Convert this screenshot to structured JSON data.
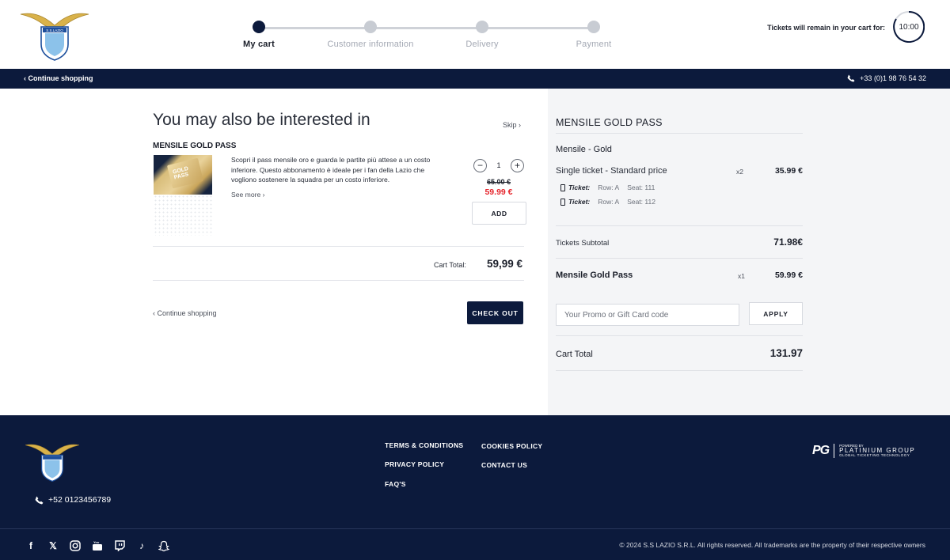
{
  "header": {
    "steps": [
      {
        "label": "My cart"
      },
      {
        "label": "Customer information"
      },
      {
        "label": "Delivery"
      },
      {
        "label": "Payment"
      }
    ],
    "timer_label": "Tickets will remain in your cart for:",
    "timer_value": "10:00"
  },
  "navbar": {
    "continue_label": "Continue shopping",
    "phone": "+33 (0)1 98 76 54 32"
  },
  "upsell": {
    "heading": "You may also be interested in",
    "skip_label": "Skip",
    "product_name": "MENSILE GOLD PASS",
    "image_text": "GOLD PASS",
    "description": "Scopri il pass mensile oro e guarda le partite più attese a un costo inferiore. Questo abbonamento è ideale per i fan della Lazio che vogliono sostenere la squadra per un costo inferiore.",
    "see_more_label": "See more",
    "quantity": "1",
    "old_price": "65.00 €",
    "new_price": "59.99 €",
    "add_label": "ADD",
    "cart_total_label": "Cart Total:",
    "cart_total_value": "59,99 €",
    "continue_label": "Continue shopping",
    "checkout_label": "CHECK OUT"
  },
  "summary": {
    "title": "MENSILE GOLD PASS",
    "subtitle": "Mensile - Gold",
    "ticket_line": {
      "label": "Single ticket - Standard price",
      "qty": "x2",
      "price": "35.99 €"
    },
    "seats": [
      {
        "ticket_label": "Ticket:",
        "row": "Row: A",
        "seat": "Seat: 111"
      },
      {
        "ticket_label": "Ticket:",
        "row": "Row: A",
        "seat": "Seat: 112"
      }
    ],
    "tickets_subtotal_label": "Tickets Subtotal",
    "tickets_subtotal_value": "71.98€",
    "gold_pass": {
      "label": "Mensile Gold Pass",
      "qty": "x1",
      "price": "59.99 €"
    },
    "promo_placeholder": "Your Promo or Gift Card code",
    "apply_label": "APPLY",
    "cart_total_label": "Cart Total",
    "cart_total_value": "131.97"
  },
  "footer": {
    "phone": "+52 0123456789",
    "links_col1": [
      "TERMS & CONDITIONS",
      "PRIVACY POLICY",
      "FAQ'S"
    ],
    "links_col2": [
      "COOKIES POLICY",
      "CONTACT US"
    ],
    "powered": {
      "line1": "POWERED BY",
      "line2": "PLATINIUM GROUP",
      "line3": "GLOBAL TICKETING TECHNOLOGY",
      "mark": "PG"
    },
    "copyright": "© 2024 S.S LAZIO S.R.L. All rights reserved. All trademarks are the property of their respective owners",
    "social_icons": [
      "facebook-icon",
      "x-icon",
      "instagram-icon",
      "youtube-icon",
      "twitch-icon",
      "tiktok-icon",
      "snapchat-icon"
    ]
  },
  "colors": {
    "navy": "#0c1a3c",
    "sale_red": "#e5242b",
    "panel_grey": "#f4f5f7"
  }
}
